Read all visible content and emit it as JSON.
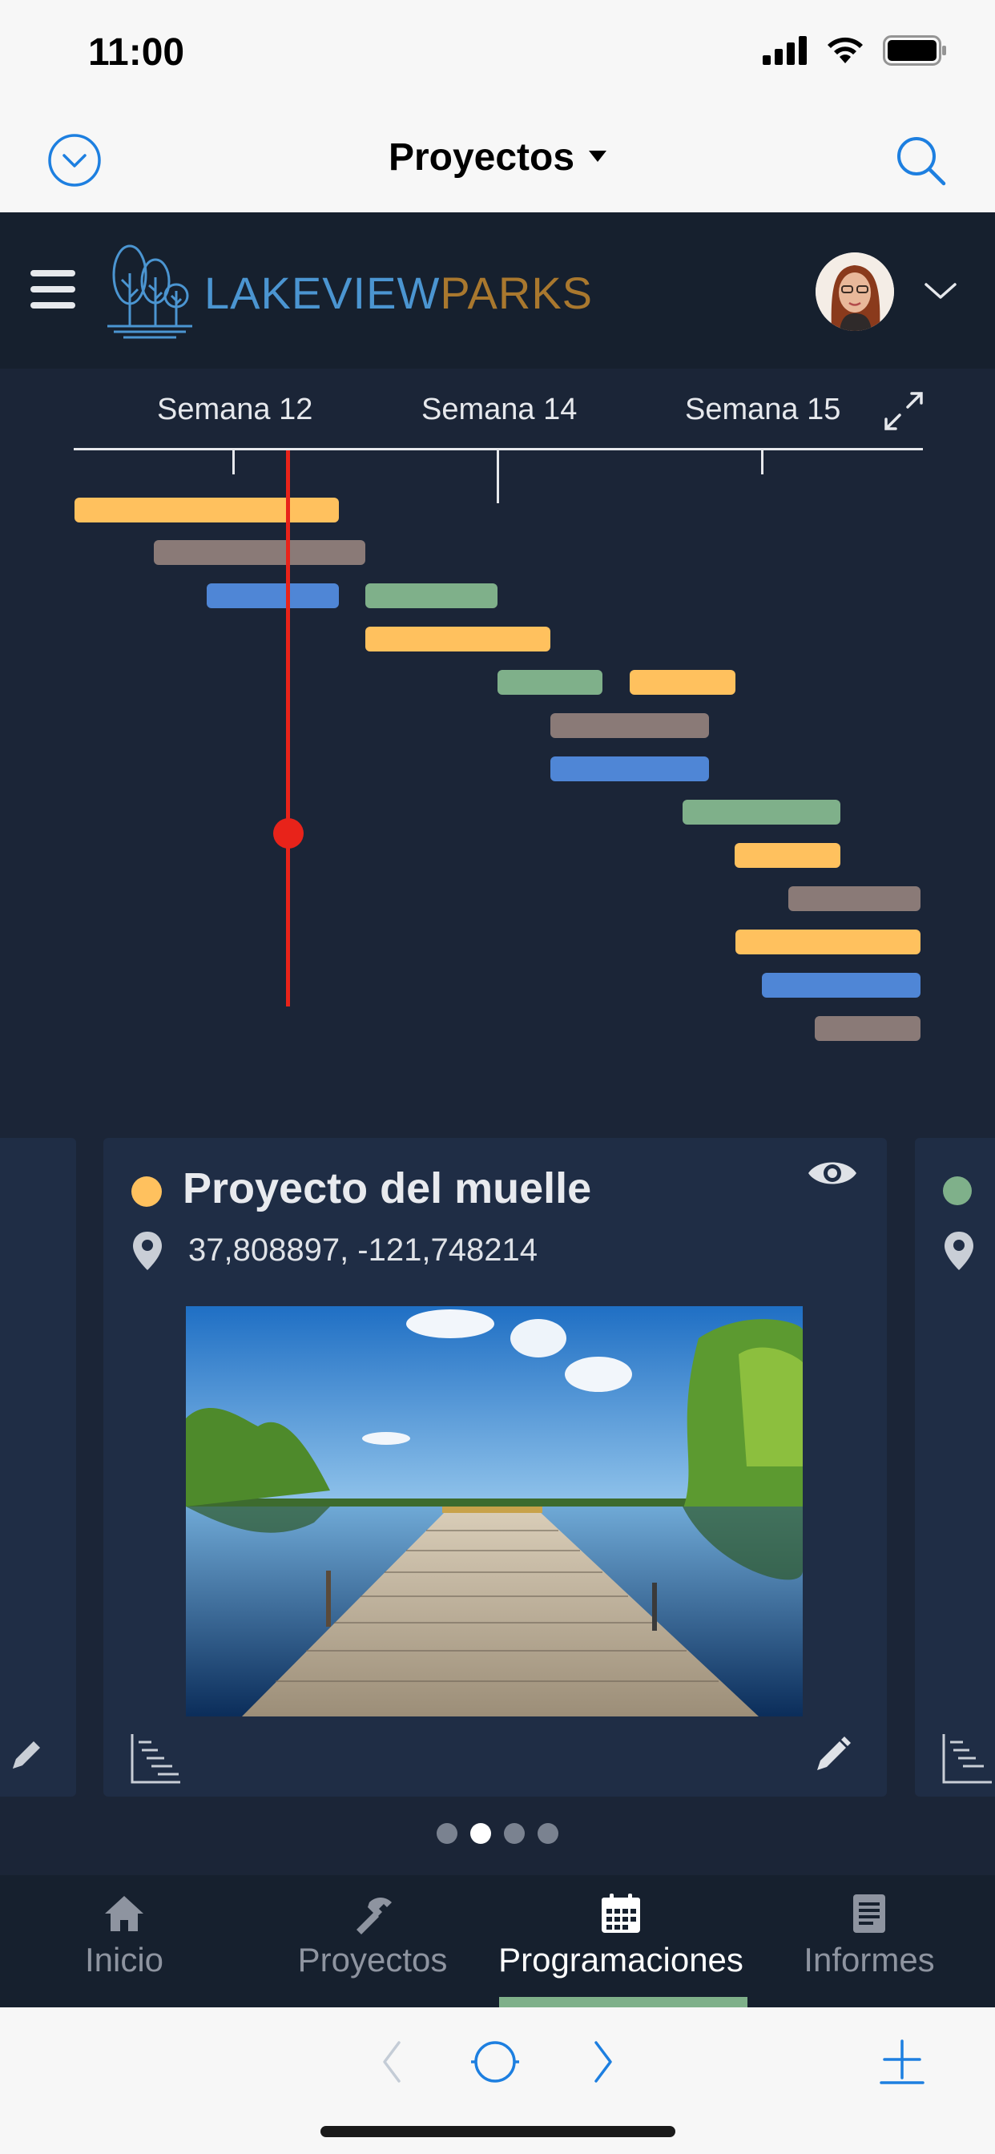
{
  "status_bar": {
    "time": "11:00"
  },
  "nav": {
    "title": "Proyectos"
  },
  "brand": {
    "name_part1": "LAKEVIEW",
    "name_part2": "PARKS",
    "color1": "#4b95d1",
    "color2": "#a9782e"
  },
  "gantt": {
    "weeks": [
      "Semana 12",
      "Semana 14",
      "Semana 15"
    ],
    "colors": {
      "yellow": "#ffc15e",
      "brown": "#8a7a77",
      "blue": "#4f86d6",
      "green": "#7fb08a"
    },
    "today_color": "#e8231a"
  },
  "card": {
    "title": "Proyecto del muelle",
    "coords": "37,808897, -121,748214",
    "status_color": "#ffc15e"
  },
  "carousel": {
    "page_count": 4,
    "active_index": 1
  },
  "tabs": [
    {
      "label": "Inicio",
      "icon": "home-icon"
    },
    {
      "label": "Proyectos",
      "icon": "hammer-icon"
    },
    {
      "label": "Programaciones",
      "icon": "calendar-icon",
      "active": true
    },
    {
      "label": "Informes",
      "icon": "report-icon"
    }
  ]
}
